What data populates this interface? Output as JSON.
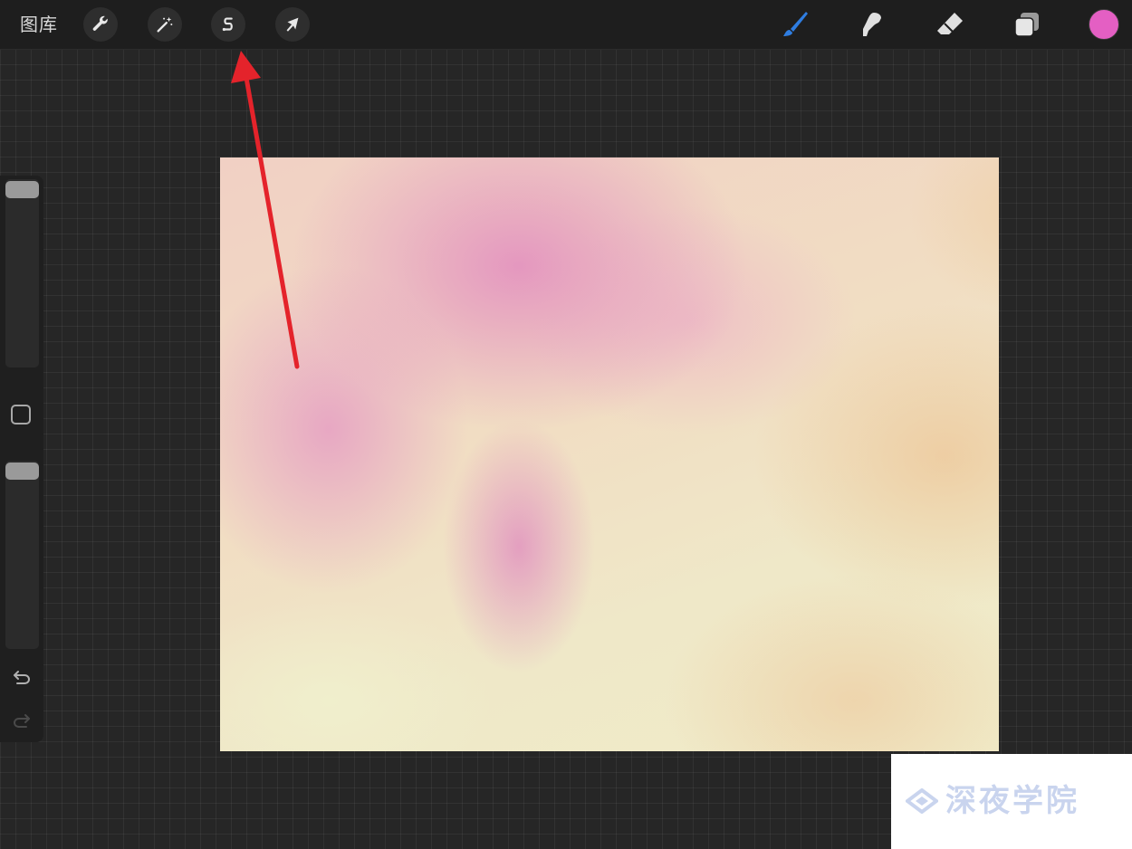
{
  "toolbar": {
    "gallery_label": "图库",
    "left_tools": [
      {
        "name": "actions",
        "icon": "wrench-icon"
      },
      {
        "name": "adjustments",
        "icon": "magic-wand-icon"
      },
      {
        "name": "selection",
        "icon": "selection-s-icon"
      },
      {
        "name": "transform",
        "icon": "arrow-cursor-icon"
      }
    ],
    "right_tools": [
      {
        "name": "brush",
        "icon": "brush-icon",
        "active": true
      },
      {
        "name": "smudge",
        "icon": "smudge-icon",
        "active": false
      },
      {
        "name": "eraser",
        "icon": "eraser-icon",
        "active": false
      },
      {
        "name": "layers",
        "icon": "layers-icon",
        "active": false
      }
    ],
    "current_color": "#e45fc3",
    "active_tool_color": "#2f7de1"
  },
  "sidebar": {
    "brush_size_level": 1.0,
    "opacity_level": 1.0,
    "modify_button_icon": "square-icon",
    "undo_icon": "undo-icon",
    "redo_icon": "redo-icon"
  },
  "annotation": {
    "type": "arrow",
    "color": "#e4232b",
    "points_to": "selection-s-icon"
  },
  "watermark": {
    "text": "深夜学院",
    "color": "#c9d4ee"
  }
}
